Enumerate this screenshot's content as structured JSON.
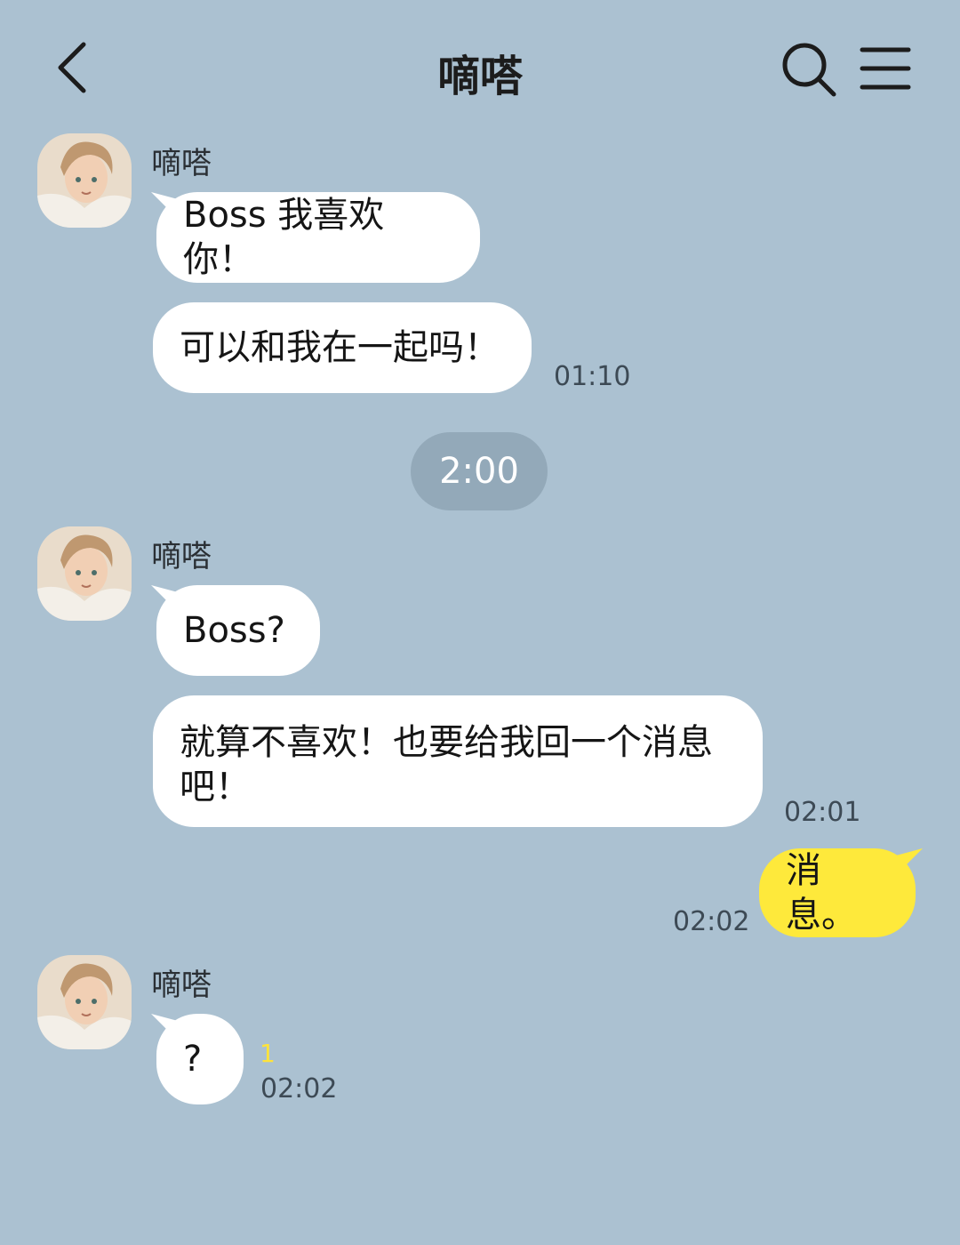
{
  "header": {
    "title": "嘀嗒",
    "back_icon": "chevron-left-icon",
    "search_icon": "search-icon",
    "menu_icon": "hamburger-menu-icon"
  },
  "colors": {
    "background": "#abc1d1",
    "incoming_bubble": "#ffffff",
    "outgoing_bubble": "#fee93b",
    "time_divider": "#93a9b9",
    "unread_badge": "#ffe33a"
  },
  "messages": {
    "group1": {
      "sender": "嘀嗒",
      "bubble1": "Boss 我喜欢你！",
      "bubble2": "可以和我在一起吗！",
      "time": "01:10"
    },
    "divider": "2:00",
    "group2": {
      "sender": "嘀嗒",
      "bubble1": "Boss?",
      "bubble2": "就算不喜欢！也要给我回一个消息吧！",
      "time": "02:01"
    },
    "mine": {
      "text": "消息。",
      "time": "02:02"
    },
    "group3": {
      "sender": "嘀嗒",
      "bubble1": "?",
      "unread": "1",
      "time": "02:02"
    }
  }
}
